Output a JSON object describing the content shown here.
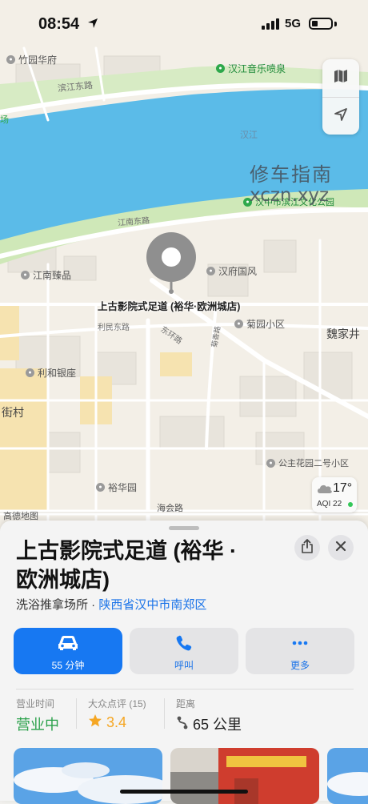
{
  "status_bar": {
    "time": "08:54",
    "network": "5G"
  },
  "map": {
    "roads": [
      "滨江东路",
      "江南东路",
      "利民东路",
      "东环路",
      "海会路",
      "菊香路"
    ],
    "water_label": "汉江",
    "pois": [
      {
        "name": "竹园华府"
      },
      {
        "name": "汉江音乐喷泉"
      },
      {
        "name": "汉中市滨江文化公园"
      },
      {
        "name": "江南臻品"
      },
      {
        "name": "汉府国风"
      },
      {
        "name": "菊园小区"
      },
      {
        "name": "利和银座"
      },
      {
        "name": "公主花园二号小区"
      },
      {
        "name": "裕华园"
      }
    ],
    "area_labels": [
      "魏家井",
      "街村",
      "场"
    ],
    "pin_label": "上古影院式足道 (裕华·欧洲城店)",
    "attribution": "高德地图",
    "weather": {
      "temp": "17°",
      "aqi": "AQI 22"
    },
    "watermark": {
      "line1": "修车指南",
      "line2": "xczn.xyz"
    }
  },
  "place": {
    "name_line1": "上古影院式足道 (裕华 ·",
    "name_line2": "欧洲城店)",
    "category": "洗浴推拿场所",
    "separator": " · ",
    "location": "陕西省汉中市南郑区",
    "actions": [
      {
        "label": "55 分钟",
        "icon": "car-icon"
      },
      {
        "label": "呼叫",
        "icon": "phone-icon"
      },
      {
        "label": "更多",
        "icon": "more-icon"
      }
    ],
    "info": {
      "hours_label": "营业时间",
      "hours_value": "营业中",
      "rating_label": "大众点评 (15)",
      "rating_value": "3.4",
      "distance_label": "距离",
      "distance_value": "65 公里"
    }
  },
  "colors": {
    "accent": "#1778f2",
    "open": "#2aa14a",
    "star": "#f5a623",
    "water": "#5bbbe8"
  }
}
